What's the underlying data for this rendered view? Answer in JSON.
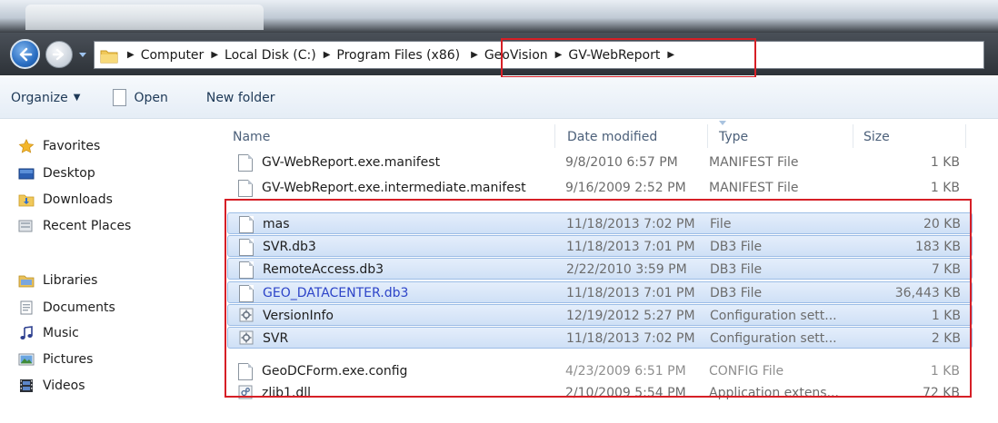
{
  "address": {
    "breadcrumbs": [
      "Computer",
      "Local Disk (C:)",
      "Program Files (x86)",
      "GeoVision",
      "GV-WebReport"
    ]
  },
  "toolbar": {
    "organize_label": "Organize",
    "open_label": "Open",
    "new_folder_label": "New folder"
  },
  "navigation": {
    "favorites": {
      "label": "Favorites",
      "items": [
        "Desktop",
        "Downloads",
        "Recent Places"
      ]
    },
    "libraries": {
      "label": "Libraries",
      "items": [
        "Documents",
        "Music",
        "Pictures",
        "Videos"
      ]
    }
  },
  "columns": {
    "name": "Name",
    "date": "Date modified",
    "type": "Type",
    "size": "Size"
  },
  "files": [
    {
      "name": "GV-WebReport.exe.manifest",
      "date": "9/8/2010 6:57 PM",
      "type": "MANIFEST File",
      "size": "1 KB",
      "icon": "document-icon",
      "selected": false
    },
    {
      "name": "GV-WebReport.exe.intermediate.manifest",
      "date": "9/16/2009 2:52 PM",
      "type": "MANIFEST File",
      "size": "1 KB",
      "icon": "document-icon",
      "selected": false
    },
    {
      "name": "mas",
      "date": "11/18/2013 7:02 PM",
      "type": "File",
      "size": "20 KB",
      "icon": "document-icon",
      "selected": true
    },
    {
      "name": "SVR.db3",
      "date": "11/18/2013 7:01 PM",
      "type": "DB3 File",
      "size": "183 KB",
      "icon": "document-icon",
      "selected": true
    },
    {
      "name": "RemoteAccess.db3",
      "date": "2/22/2010 3:59 PM",
      "type": "DB3 File",
      "size": "7 KB",
      "icon": "document-icon",
      "selected": true
    },
    {
      "name": "GEO_DATACENTER.db3",
      "date": "11/18/2013 7:01 PM",
      "type": "DB3 File",
      "size": "36,443 KB",
      "icon": "document-icon",
      "selected": true
    },
    {
      "name": "VersionInfo",
      "date": "12/19/2012 5:27 PM",
      "type": "Configuration sett...",
      "size": "1 KB",
      "icon": "settings-file-icon",
      "selected": true
    },
    {
      "name": "SVR",
      "date": "11/18/2013 7:02 PM",
      "type": "Configuration sett...",
      "size": "2 KB",
      "icon": "settings-file-icon",
      "selected": true
    },
    {
      "name": "GeoDCForm.exe.config",
      "date": "4/23/2009 6:51 PM",
      "type": "CONFIG File",
      "size": "1 KB",
      "icon": "document-icon",
      "selected": false
    },
    {
      "name": "zlib1.dll",
      "date": "2/10/2009 5:54 PM",
      "type": "Application extens...",
      "size": "72 KB",
      "icon": "dll-file-icon",
      "selected": false
    }
  ],
  "colors": {
    "highlight_border": "#d61f26",
    "selection_fill": "#d9e7f8",
    "link_blue": "#2d44c8"
  }
}
